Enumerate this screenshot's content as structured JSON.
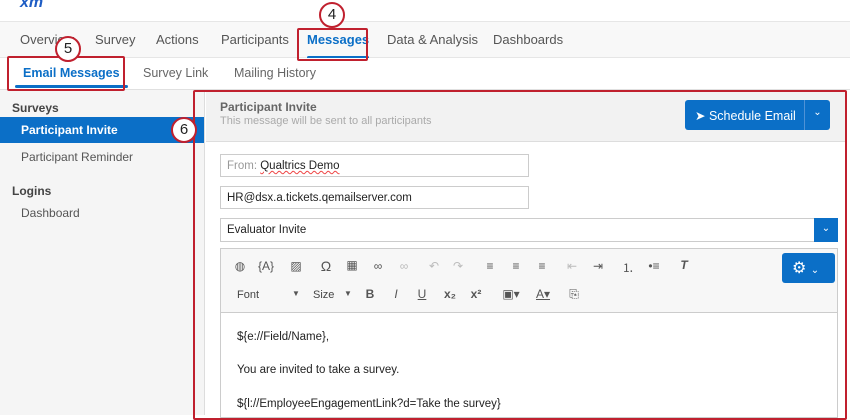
{
  "logo": "xm",
  "nav": {
    "tabs": [
      "Overview",
      "Survey",
      "Actions",
      "Participants",
      "Messages",
      "Data & Analysis",
      "Dashboards"
    ],
    "active": "Messages"
  },
  "subnav": {
    "tabs": [
      "Email Messages",
      "Survey Link",
      "Mailing History"
    ],
    "active": "Email Messages"
  },
  "sidebar": {
    "sections": [
      {
        "heading": "Surveys",
        "items": [
          "Participant Invite",
          "Participant Reminder"
        ]
      },
      {
        "heading": "Logins",
        "items": [
          "Dashboard"
        ]
      }
    ],
    "selected": "Participant Invite"
  },
  "message": {
    "title": "Participant Invite",
    "subtitle": "This message will be sent to all participants",
    "schedule_label": "Schedule Email",
    "from_label": "From:",
    "from_value": "Qualtrics Demo",
    "reply_to": "HR@dsx.a.tickets.qemailserver.com",
    "subject": "Evaluator Invite"
  },
  "toolbar": {
    "font": "Font",
    "size": "Size"
  },
  "body": [
    "${e://Field/Name},",
    "You are invited to take a survey.",
    "${l://EmployeeEngagementLink?d=Take the survey}"
  ],
  "annotations": [
    "4",
    "5",
    "6"
  ],
  "colors": {
    "accent": "#0b6fc7",
    "annotation": "#c0202e"
  }
}
